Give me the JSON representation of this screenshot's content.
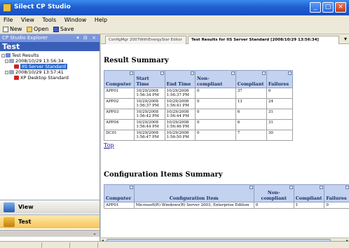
{
  "window": {
    "title": "Silect CP Studio"
  },
  "menu": [
    "File",
    "View",
    "Tools",
    "Window",
    "Help"
  ],
  "toolbar": {
    "new_label": "New",
    "open_label": "Open",
    "save_label": "Save"
  },
  "explorer": {
    "header": "CP Studio Explorer",
    "title": "Test",
    "tree": {
      "root": "Test Results",
      "run1": "2008/10/29 13:56:34",
      "run1_child": "IIS Server Standard",
      "run2": "2008/10/29 13:57:41",
      "run2_child": "XP Desktop Standard"
    },
    "nav": {
      "view": "View",
      "test": "Test"
    }
  },
  "tabs": [
    "ConfigMgr 2007WithEnergyStar Editor",
    "Test Results for IIS Server Standard [2008/10/29 13:56:34]"
  ],
  "result_summary": {
    "title": "Result Summary",
    "columns": [
      "Computer",
      "Start Time",
      "End Time",
      "Non-compliant",
      "Compliant",
      "Failures"
    ],
    "rows": [
      [
        "APP01",
        "10/29/2008 1:56:34 PM",
        "10/29/2008 1:56:37 PM",
        "0",
        "37",
        "0"
      ],
      [
        "APP02",
        "10/29/2008 1:56:37 PM",
        "10/29/2008 1:56:41 PM",
        "0",
        "13",
        "24"
      ],
      [
        "APP03",
        "10/29/2008 1:56:42 PM",
        "10/29/2008 1:56:44 PM",
        "0",
        "6",
        "31"
      ],
      [
        "APP04",
        "10/29/2008 1:56:44 PM",
        "10/29/2008 1:56:46 PM",
        "0",
        "6",
        "31"
      ],
      [
        "DC01",
        "10/29/2008 1:56:47 PM",
        "10/29/2008 1:56:50 PM",
        "0",
        "7",
        "30"
      ]
    ]
  },
  "top_link": "Top",
  "config_summary": {
    "title": "Configuration Items Summary",
    "columns": [
      "Computer",
      "Configuration Item",
      "Non-compliant",
      "Compliant",
      "Failures"
    ],
    "rows": [
      [
        "APP01",
        "Microsoft(R) Windows(R) Server 2003, Enterprise Edition",
        "0",
        "1",
        "0"
      ]
    ]
  },
  "colors": {
    "title_bar": "#1f5fd0",
    "header_bg": "#c3d2ee",
    "selection": "#316ac5"
  }
}
